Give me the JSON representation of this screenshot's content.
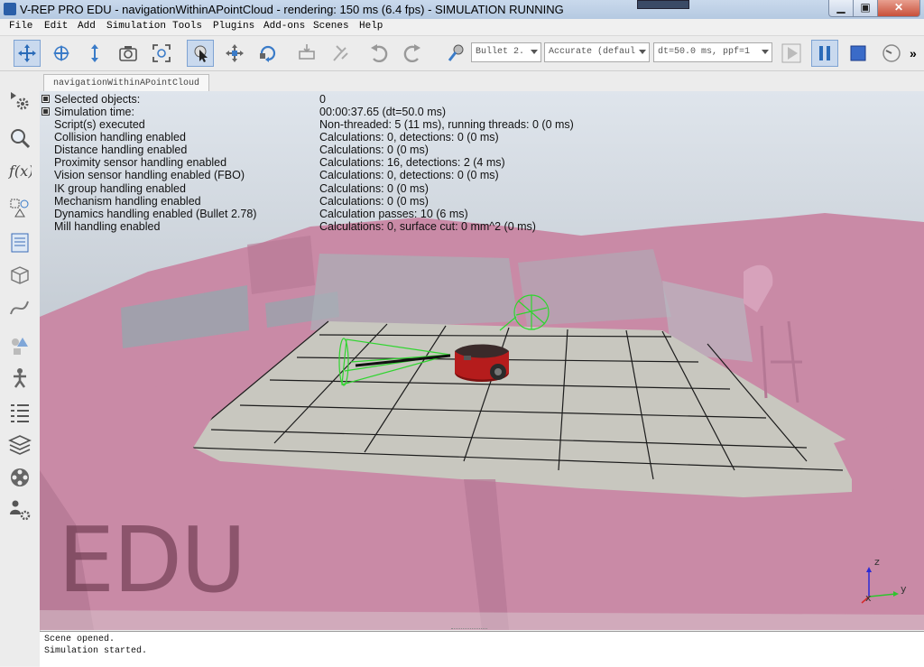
{
  "window": {
    "title": "V-REP PRO EDU - navigationWithinAPointCloud - rendering: 150 ms (6.4 fps) - SIMULATION RUNNING",
    "minimize": "▁",
    "maximize": "▣",
    "close": "✕"
  },
  "menu": [
    "File",
    "Edit",
    "Add",
    "Simulation",
    "Tools",
    "Plugins",
    "Add-ons",
    "Scenes",
    "Help"
  ],
  "toolbar": {
    "engine": "Bullet 2.",
    "accuracy": "Accurate (defaul",
    "timestep": "dt=50.0 ms, ppf=1",
    "more": "»"
  },
  "tab": {
    "label": "navigationWithinAPointCloud"
  },
  "info": {
    "rows": [
      {
        "label": "Selected objects:",
        "value": "0"
      },
      {
        "label": "Simulation time:",
        "value": "00:00:37.65 (dt=50.0 ms)"
      },
      {
        "label": "Script(s) executed",
        "value": "Non-threaded: 5 (11 ms), running threads: 0 (0 ms)"
      },
      {
        "label": "Collision handling enabled",
        "value": "Calculations: 0, detections: 0 (0 ms)"
      },
      {
        "label": "Distance handling enabled",
        "value": "Calculations: 0 (0 ms)"
      },
      {
        "label": "Proximity sensor handling enabled",
        "value": "Calculations: 16, detections: 2 (4 ms)"
      },
      {
        "label": "Vision sensor handling enabled (FBO)",
        "value": "Calculations: 0, detections: 0 (0 ms)"
      },
      {
        "label": "IK group handling enabled",
        "value": "Calculations: 0 (0 ms)"
      },
      {
        "label": "Mechanism handling enabled",
        "value": "Calculations: 0 (0 ms)"
      },
      {
        "label": "Dynamics handling enabled (Bullet 2.78)",
        "value": "Calculation passes: 10 (6 ms)"
      },
      {
        "label": "Mill handling enabled",
        "value": "Calculations: 0, surface cut: 0 mm^2 (0 ms)"
      }
    ]
  },
  "watermark": "EDU",
  "axes": {
    "z": "z",
    "y": "y",
    "x": "x"
  },
  "console": {
    "lines": [
      "Scene opened.",
      "Simulation started."
    ]
  },
  "colors": {
    "pointcloud": "#c98aa6",
    "floor_tile": "#c8c7bf",
    "background_top": "#d8e0e8",
    "background_bottom": "#a9b2bb",
    "sensor": "#2fd52f",
    "robot": "#b51c1c"
  }
}
